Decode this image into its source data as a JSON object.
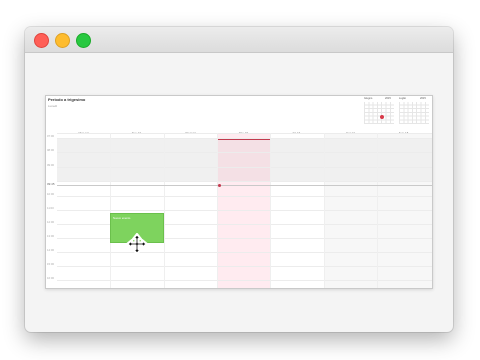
{
  "window": {
    "buttons": [
      "close",
      "minimize",
      "maximize"
    ]
  },
  "calendar": {
    "title": "Periodo a trigesimo",
    "subtitle": "Lunedì",
    "mini_calendars": [
      {
        "month": "Giugno",
        "year": "2015"
      },
      {
        "month": "Luglio",
        "year": "2015"
      }
    ],
    "days": [
      "Mon 12",
      "Tue 13",
      "Wed 14",
      "Thu 15",
      "Fri 16",
      "Sat 17",
      "Sun 18"
    ],
    "times": [
      "07:00",
      "08:00",
      "09:00",
      "10:00",
      "11:00",
      "12:00",
      "13:00",
      "14:00",
      "15:00",
      "16:00",
      "17:00"
    ],
    "now_time": "09:45",
    "event": {
      "label": "Nuovo evento",
      "color": "#7ed35e"
    },
    "today_color": "#c23a4e",
    "cursor": "move-cursor-icon"
  }
}
